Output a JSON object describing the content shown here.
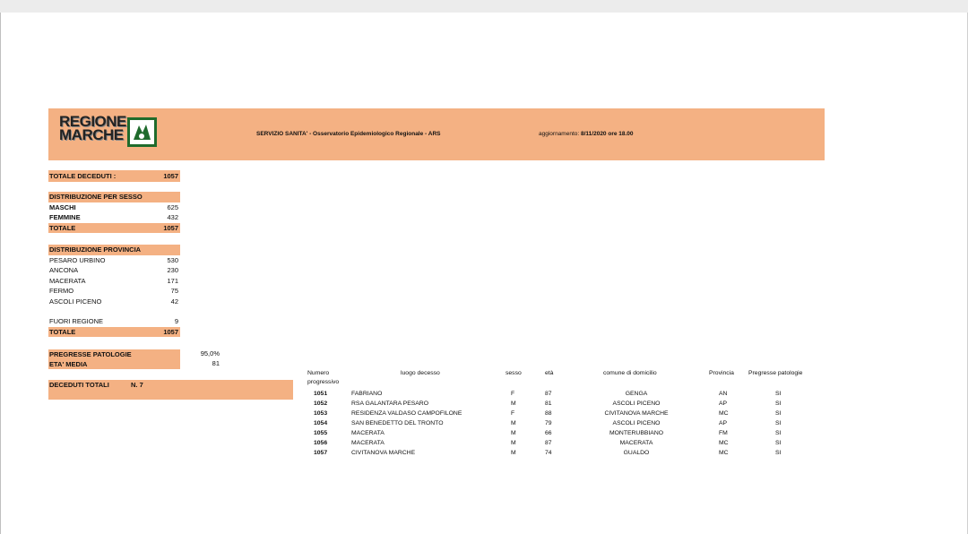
{
  "header": {
    "logo_line1": "REGIONE",
    "logo_line2": "MARCHE",
    "title": "SERVIZIO SANITA' - Osservatorio Epidemiologico Regionale - ARS",
    "update_label": "aggiornamento:",
    "update_value": "8/11/2020 ore 18.00"
  },
  "totale_deceduti": {
    "label": "TOTALE DECEDUTI :",
    "value": "1057"
  },
  "sesso": {
    "title": "DISTRIBUZIONE PER SESSO",
    "rows": [
      {
        "label": "MASCHI",
        "value": "625"
      },
      {
        "label": "FEMMINE",
        "value": "432"
      }
    ],
    "total": {
      "label": "TOTALE",
      "value": "1057"
    }
  },
  "provincia": {
    "title": "DISTRIBUZIONE  PROVINCIA",
    "rows": [
      {
        "label": "PESARO URBINO",
        "value": "530"
      },
      {
        "label": "ANCONA",
        "value": "230"
      },
      {
        "label": "MACERATA",
        "value": "171"
      },
      {
        "label": "FERMO",
        "value": "75"
      },
      {
        "label": "ASCOLI PICENO",
        "value": "42"
      }
    ],
    "fuori": {
      "label": "FUORI REGIONE",
      "value": "9"
    },
    "total": {
      "label": "TOTALE",
      "value": "1057"
    }
  },
  "patologie": {
    "label": "PREGRESSE PATOLOGIE",
    "value": "95,0%"
  },
  "eta_media": {
    "label": "ETA' MEDIA",
    "value": "81"
  },
  "deceduti_totali": {
    "label": "DECEDUTI TOTALI",
    "value": "N. 7"
  },
  "table": {
    "headers": {
      "numero": "Numero",
      "progressivo": "progressivo",
      "luogo": "luogo decesso",
      "sesso": "sesso",
      "eta": "età",
      "comune": "comune di domicilio",
      "provincia": "Provincia",
      "patologie": "Pregresse patologie"
    },
    "rows": [
      {
        "n": "1051",
        "luogo": "FABRIANO",
        "sesso": "F",
        "eta": "87",
        "comune": "GENGA",
        "prov": "AN",
        "pat": "SI"
      },
      {
        "n": "1052",
        "luogo": "RSA GALANTARA PESARO",
        "sesso": "M",
        "eta": "81",
        "comune": "ASCOLI PICENO",
        "prov": "AP",
        "pat": "SI"
      },
      {
        "n": "1053",
        "luogo": "RESIDENZA VALDASO CAMPOFILONE",
        "sesso": "F",
        "eta": "88",
        "comune": "CIVITANOVA MARCHE",
        "prov": "MC",
        "pat": "SI"
      },
      {
        "n": "1054",
        "luogo": "SAN BENEDETTO DEL TRONTO",
        "sesso": "M",
        "eta": "79",
        "comune": "ASCOLI PICENO",
        "prov": "AP",
        "pat": "SI"
      },
      {
        "n": "1055",
        "luogo": "MACERATA",
        "sesso": "M",
        "eta": "66",
        "comune": "MONTERUBBIANO",
        "prov": "FM",
        "pat": "SI"
      },
      {
        "n": "1056",
        "luogo": "MACERATA",
        "sesso": "M",
        "eta": "87",
        "comune": "MACERATA",
        "prov": "MC",
        "pat": "SI"
      },
      {
        "n": "1057",
        "luogo": "CIVITANOVA MARCHE",
        "sesso": "M",
        "eta": "74",
        "comune": "GUALDO",
        "prov": "MC",
        "pat": "SI"
      }
    ]
  },
  "colors": {
    "accent": "#f4b183",
    "logo_green": "#1f6b2c"
  }
}
